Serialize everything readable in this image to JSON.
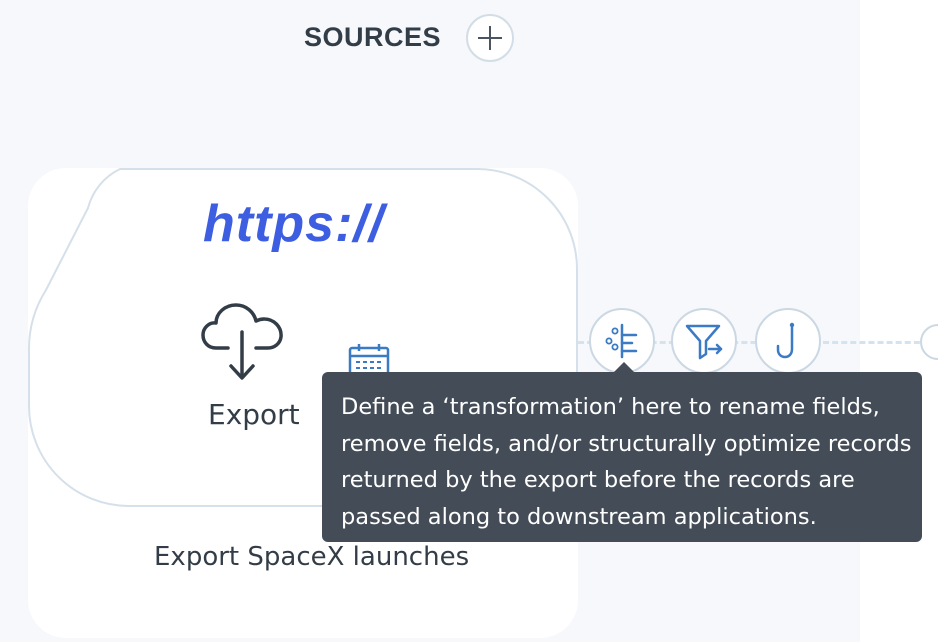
{
  "header": {
    "title": "SOURCES",
    "add_icon": "plus-icon"
  },
  "source_card": {
    "protocol_text": "https://",
    "action_icon": "cloud-download-icon",
    "action_label": "Export",
    "schedule_icon": "calendar-icon",
    "name": "Export SpaceX launches"
  },
  "pipeline_steps": [
    {
      "icon": "transformation-icon"
    },
    {
      "icon": "filter-icon"
    },
    {
      "icon": "hook-icon"
    }
  ],
  "tooltip": {
    "text": "Define a ‘transformation’ here to rename fields, remove fields, and/or structurally optimize records returned by the export before the records are passed along to downstream applications."
  },
  "colors": {
    "accent": "#3d5ee0",
    "icon_blue": "#3b7ac4",
    "text": "#333d47",
    "tooltip_bg": "#434c57",
    "panel_bg": "#f6f8fb",
    "border": "#cbd8e3"
  }
}
